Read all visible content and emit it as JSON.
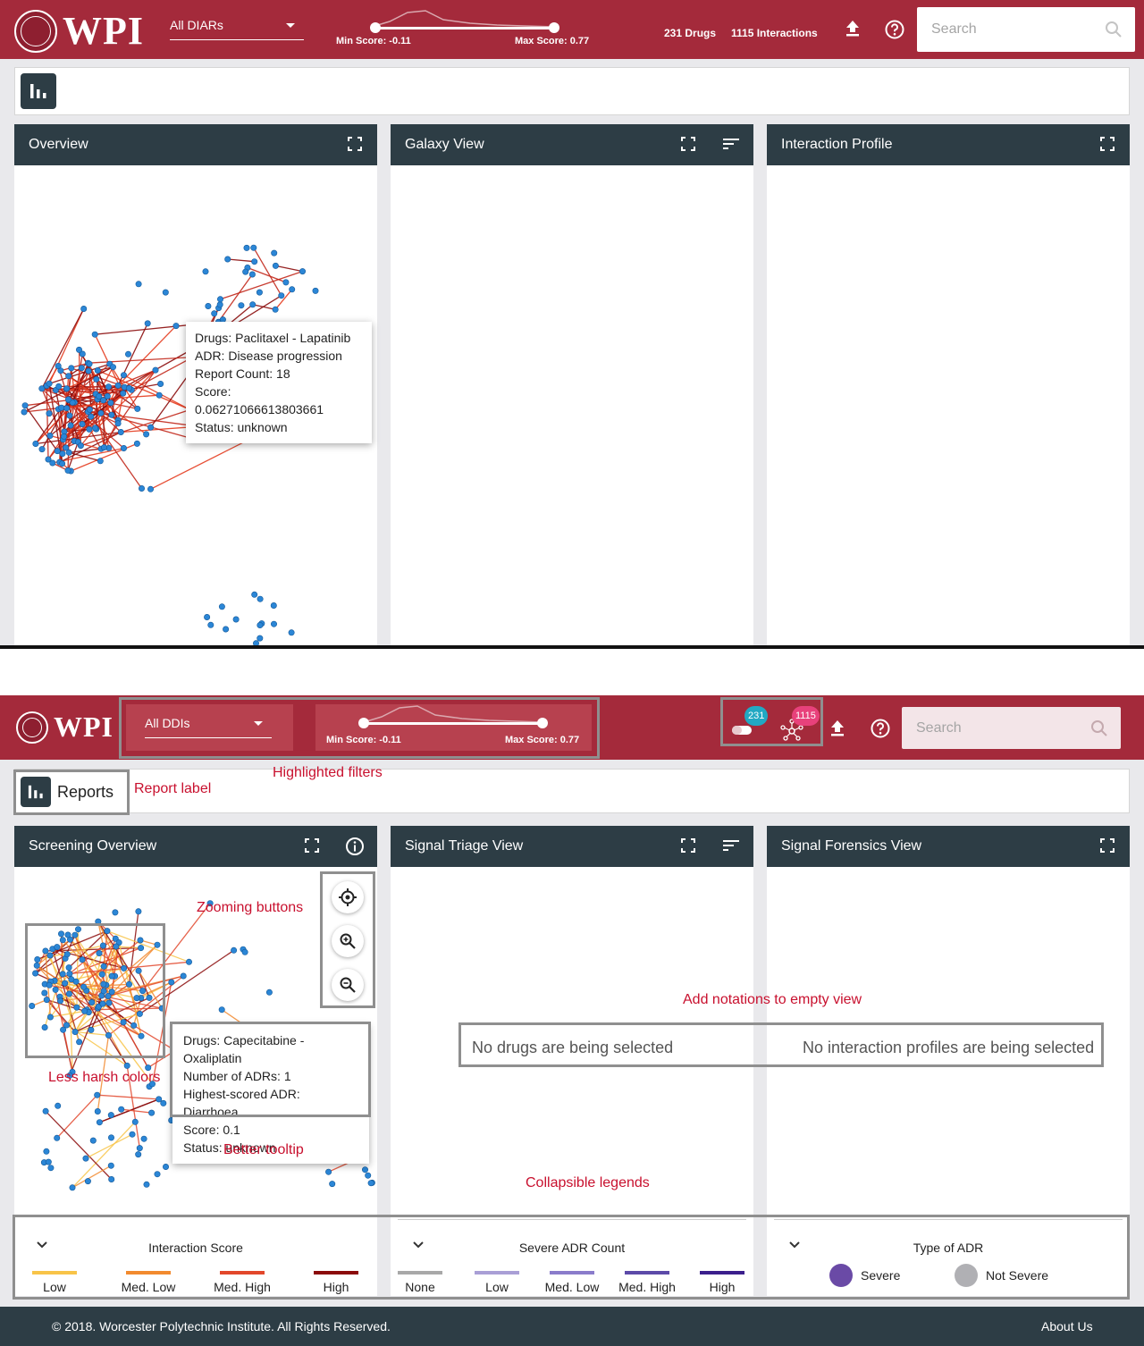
{
  "before": {
    "logo_text": "WPI",
    "dropdown_value": "All DIARs",
    "min_score_label": "Min Score: -0.11",
    "max_score_label": "Max Score: 0.77",
    "drugs_count_label": "231 Drugs",
    "interactions_count_label": "1115 Interactions",
    "search_placeholder": "Search",
    "panels": {
      "overview": "Overview",
      "galaxy": "Galaxy View",
      "profile": "Interaction Profile"
    },
    "tooltip": [
      "Drugs: Paclitaxel - Lapatinib",
      "ADR: Disease progression",
      "Report Count: 18",
      "Score: 0.06271066613803661",
      "Status: unknown"
    ],
    "edge_colors": [
      "#e43b1e",
      "#c2281b",
      "#8b0b0b"
    ]
  },
  "after": {
    "logo_text": "WPI",
    "dropdown_value": "All DDIs",
    "min_score_label": "Min Score: -0.11",
    "max_score_label": "Max Score: 0.77",
    "drugs_badge": "231",
    "interactions_badge": "1115",
    "search_placeholder": "Search",
    "reports_label": "Reports",
    "panels": {
      "overview": "Screening Overview",
      "triage": "Signal Triage View",
      "forensics": "Signal Forensics View"
    },
    "tooltip": [
      "Drugs: Capecitabine - Oxaliplatin",
      "Number of ADRs: 1",
      "Highest-scored ADR: Diarrhoea",
      "Score: 0.1",
      "Status: unknown"
    ],
    "empty_triage": "No drugs are being selected",
    "empty_forensics": "No interaction profiles are being selected",
    "annotations": {
      "report_label": "Report label",
      "highlighted_filters": "Highlighted filters",
      "zooming_buttons": "Zooming buttons",
      "less_harsh_colors": "Less harsh colors",
      "better_tooltip": "Better tooltip",
      "add_notations": "Add notations to empty view",
      "collapsible_legends": "Collapsible legends"
    },
    "legend_interaction": {
      "title": "Interaction Score",
      "items": [
        {
          "label": "Low",
          "color": "#f8c448"
        },
        {
          "label": "Med. Low",
          "color": "#f28a2f"
        },
        {
          "label": "Med. High",
          "color": "#e2472b"
        },
        {
          "label": "High",
          "color": "#8b0a0a"
        }
      ]
    },
    "legend_severe": {
      "title": "Severe ADR Count",
      "items": [
        {
          "label": "None",
          "color": "#a8a8a8"
        },
        {
          "label": "Low",
          "color": "#a99fd6"
        },
        {
          "label": "Med. Low",
          "color": "#8a7ccb"
        },
        {
          "label": "Med. High",
          "color": "#5c4aa8"
        },
        {
          "label": "High",
          "color": "#3b1f8c"
        }
      ]
    },
    "legend_type": {
      "title": "Type of ADR",
      "items": [
        {
          "label": "Severe",
          "color": "#6a4aa6"
        },
        {
          "label": "Not Severe",
          "color": "#b0b0b4"
        }
      ]
    },
    "edge_colors": [
      "#f8c448",
      "#f28a2f",
      "#e2472b",
      "#8b0a0a"
    ],
    "footer_copyright": "© 2018. Worcester Polytechnic Institute. All Rights Reserved.",
    "footer_about": "About Us"
  }
}
